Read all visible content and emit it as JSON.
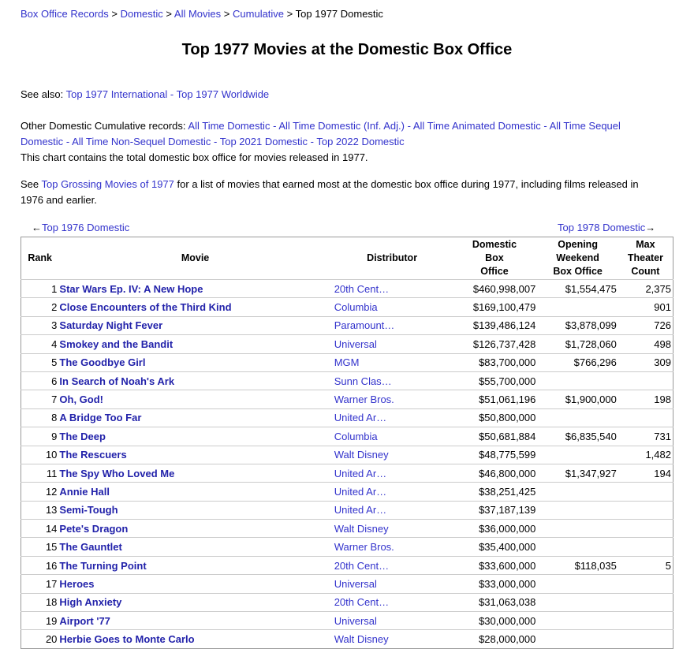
{
  "breadcrumb": {
    "items": [
      "Box Office Records",
      "Domestic",
      "All Movies",
      "Cumulative"
    ],
    "current": "Top 1977 Domestic",
    "separator": ">"
  },
  "page_title": "Top 1977 Movies at the Domestic Box Office",
  "see_also": {
    "prefix": "See also:",
    "link1": "Top 1977 International",
    "dash": "-",
    "link2": "Top 1977 Worldwide"
  },
  "other_records": {
    "prefix": "Other Domestic Cumulative records:",
    "links": [
      "All Time Domestic",
      "All Time Domestic (Inf. Adj.)",
      "All Time Animated Domestic",
      "All Time Sequel Domestic",
      "All Time Non-Sequel Domestic",
      "Top 2021 Domestic",
      "Top 2022 Domestic"
    ]
  },
  "chart_note": "This chart contains the total domestic box office for movies released in 1977.",
  "see_grossing": {
    "prefix": "See",
    "link": "Top Grossing Movies of 1977",
    "suffix": "for a list of movies that earned most at the domestic box office during 1977, including films released in 1976 and earlier."
  },
  "nav": {
    "prev_arrow": "←",
    "prev_label": "Top 1976 Domestic",
    "next_label": "Top 1978 Domestic",
    "next_arrow": "→"
  },
  "table": {
    "headers": {
      "rank": "Rank",
      "movie": "Movie",
      "distributor": "Distributor",
      "gross_l1": "Domestic",
      "gross_l2": "Box",
      "gross_l3": "Office",
      "open_l1": "Opening",
      "open_l2": "Weekend",
      "open_l3": "Box Office",
      "max_l1": "Max",
      "max_l2": "Theater",
      "max_l3": "Count"
    },
    "rows": [
      {
        "rank": "1",
        "movie": "Star Wars Ep. IV: A New Hope",
        "distributor": "20th Cent…",
        "gross": "$460,998,007",
        "opening": "$1,554,475",
        "theaters": "2,375"
      },
      {
        "rank": "2",
        "movie": "Close Encounters of the Third Kind",
        "distributor": "Columbia",
        "gross": "$169,100,479",
        "opening": "",
        "theaters": "901"
      },
      {
        "rank": "3",
        "movie": "Saturday Night Fever",
        "distributor": "Paramount…",
        "gross": "$139,486,124",
        "opening": "$3,878,099",
        "theaters": "726"
      },
      {
        "rank": "4",
        "movie": "Smokey and the Bandit",
        "distributor": "Universal",
        "gross": "$126,737,428",
        "opening": "$1,728,060",
        "theaters": "498"
      },
      {
        "rank": "5",
        "movie": "The Goodbye Girl",
        "distributor": "MGM",
        "gross": "$83,700,000",
        "opening": "$766,296",
        "theaters": "309"
      },
      {
        "rank": "6",
        "movie": "In Search of Noah's Ark",
        "distributor": "Sunn Clas…",
        "gross": "$55,700,000",
        "opening": "",
        "theaters": ""
      },
      {
        "rank": "7",
        "movie": "Oh, God!",
        "distributor": "Warner Bros.",
        "gross": "$51,061,196",
        "opening": "$1,900,000",
        "theaters": "198"
      },
      {
        "rank": "8",
        "movie": "A Bridge Too Far",
        "distributor": "United Ar…",
        "gross": "$50,800,000",
        "opening": "",
        "theaters": ""
      },
      {
        "rank": "9",
        "movie": "The Deep",
        "distributor": "Columbia",
        "gross": "$50,681,884",
        "opening": "$6,835,540",
        "theaters": "731"
      },
      {
        "rank": "10",
        "movie": "The Rescuers",
        "distributor": "Walt Disney",
        "gross": "$48,775,599",
        "opening": "",
        "theaters": "1,482"
      },
      {
        "rank": "11",
        "movie": "The Spy Who Loved Me",
        "distributor": "United Ar…",
        "gross": "$46,800,000",
        "opening": "$1,347,927",
        "theaters": "194"
      },
      {
        "rank": "12",
        "movie": "Annie Hall",
        "distributor": "United Ar…",
        "gross": "$38,251,425",
        "opening": "",
        "theaters": ""
      },
      {
        "rank": "13",
        "movie": "Semi-Tough",
        "distributor": "United Ar…",
        "gross": "$37,187,139",
        "opening": "",
        "theaters": ""
      },
      {
        "rank": "14",
        "movie": "Pete's Dragon",
        "distributor": "Walt Disney",
        "gross": "$36,000,000",
        "opening": "",
        "theaters": ""
      },
      {
        "rank": "15",
        "movie": "The Gauntlet",
        "distributor": "Warner Bros.",
        "gross": "$35,400,000",
        "opening": "",
        "theaters": ""
      },
      {
        "rank": "16",
        "movie": "The Turning Point",
        "distributor": "20th Cent…",
        "gross": "$33,600,000",
        "opening": "$118,035",
        "theaters": "5"
      },
      {
        "rank": "17",
        "movie": "Heroes",
        "distributor": "Universal",
        "gross": "$33,000,000",
        "opening": "",
        "theaters": ""
      },
      {
        "rank": "18",
        "movie": "High Anxiety",
        "distributor": "20th Cent…",
        "gross": "$31,063,038",
        "opening": "",
        "theaters": ""
      },
      {
        "rank": "19",
        "movie": "Airport '77",
        "distributor": "Universal",
        "gross": "$30,000,000",
        "opening": "",
        "theaters": ""
      },
      {
        "rank": "20",
        "movie": "Herbie Goes to Monte Carlo",
        "distributor": "Walt Disney",
        "gross": "$28,000,000",
        "opening": "",
        "theaters": ""
      }
    ]
  },
  "colors": {
    "link": "#3333cc",
    "movie_link": "#2222aa",
    "border": "#999999"
  }
}
